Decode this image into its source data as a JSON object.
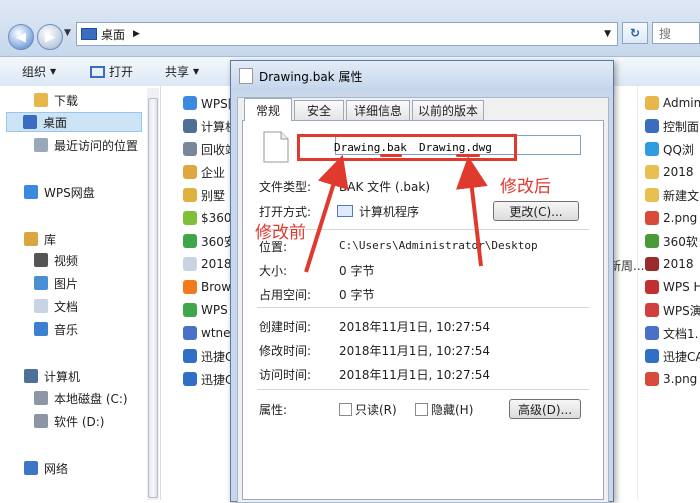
{
  "explorer": {
    "breadcrumb": "桌面",
    "toolbar": {
      "organize": "组织",
      "open": "打开",
      "share": "共享"
    },
    "sidebar": [
      {
        "label": "下载",
        "icon": "download-folder-icon"
      },
      {
        "label": "桌面",
        "icon": "desktop-icon",
        "selected": true
      },
      {
        "label": "最近访问的位置",
        "icon": "recent-places-icon"
      },
      {
        "label": "WPS网盘",
        "icon": "wps-cloud-icon"
      },
      {
        "label": "库",
        "icon": "library-icon"
      },
      {
        "label": "视频",
        "icon": "video-icon"
      },
      {
        "label": "图片",
        "icon": "picture-icon"
      },
      {
        "label": "文档",
        "icon": "document-icon"
      },
      {
        "label": "音乐",
        "icon": "music-icon"
      },
      {
        "label": "计算机",
        "icon": "computer-icon"
      },
      {
        "label": "本地磁盘 (C:)",
        "icon": "disk-icon"
      },
      {
        "label": "软件 (D:)",
        "icon": "disk-icon"
      },
      {
        "label": "网络",
        "icon": "network-icon"
      }
    ],
    "files_left": [
      "WPS网",
      "计算机",
      "回收站",
      "企业",
      "别墅",
      "$360",
      "360安",
      "2018",
      "Brow",
      "WPS",
      "wtne",
      "迅捷C",
      "迅捷C"
    ],
    "files_right": [
      "Admin",
      "控制面",
      "QQ浏",
      "2018",
      "新建文",
      "2.png",
      "360软",
      "2018",
      "WPS H",
      "WPS演",
      "文档1.",
      "迅捷CA",
      "3.png"
    ],
    "files_mid_fragment": "新周..."
  },
  "dialog": {
    "title": "Drawing.bak 属性",
    "tabs": [
      "常规",
      "安全",
      "详细信息",
      "以前的版本"
    ],
    "filename_before": "Drawing.bak",
    "filename_after": "Drawing.dwg",
    "file_type_label": "文件类型:",
    "file_type_value": "BAK 文件 (.bak)",
    "open_with_label": "打开方式:",
    "open_with_value": "计算机程序",
    "change_button": "更改(C)...",
    "location_label": "位置:",
    "location_value": "C:\\Users\\Administrator\\Desktop",
    "size_label": "大小:",
    "size_value": "0 字节",
    "disk_size_label": "占用空间:",
    "disk_size_value": "0 字节",
    "created_label": "创建时间:",
    "created_value": "2018年11月1日, 10:27:54",
    "modified_label": "修改时间:",
    "modified_value": "2018年11月1日, 10:27:54",
    "accessed_label": "访问时间:",
    "accessed_value": "2018年11月1日, 10:27:54",
    "attributes_label": "属性:",
    "readonly_label": "只读(R)",
    "hidden_label": "隐藏(H)",
    "advanced_button": "高级(D)..."
  },
  "annotations": {
    "before": "修改前",
    "after": "修改后",
    "color": "#e03a2f"
  }
}
